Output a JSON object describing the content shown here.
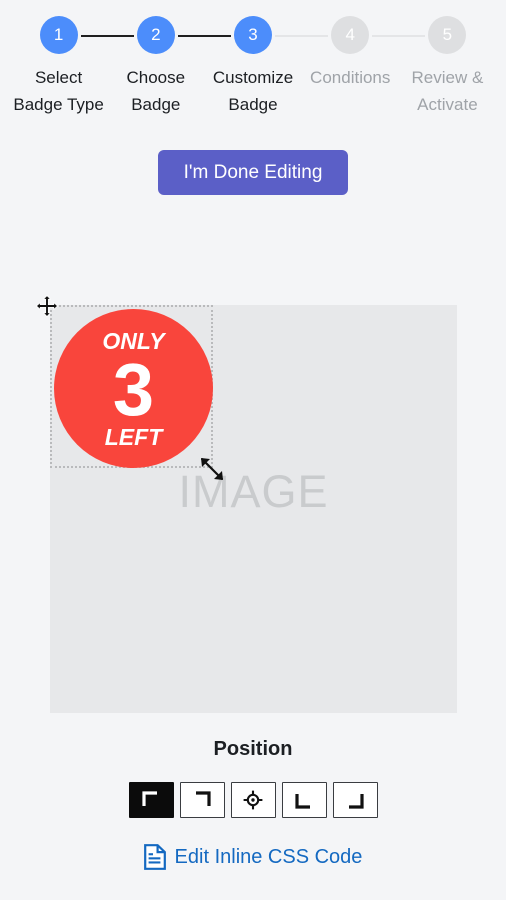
{
  "stepper": {
    "steps": [
      {
        "number": "1",
        "label": "Select Badge Type",
        "state": "done"
      },
      {
        "number": "2",
        "label": "Choose Badge",
        "state": "done"
      },
      {
        "number": "3",
        "label": "Customize Badge",
        "state": "done"
      },
      {
        "number": "4",
        "label": "Conditions",
        "state": "todo"
      },
      {
        "number": "5",
        "label": "Review & Activate",
        "state": "todo"
      }
    ],
    "active_color": "#4c8dfb",
    "inactive_color": "#dedfe1"
  },
  "toolbar": {
    "done_label": "I'm Done Editing",
    "done_color": "#5b5fc7"
  },
  "canvas": {
    "image_placeholder": "IMAGE",
    "badge": {
      "top_text": "ONLY",
      "number": "3",
      "bottom_text": "LEFT",
      "color": "#f9453c",
      "text_color": "#ffffff",
      "shape": "circle"
    },
    "move_handle": "move-arrows-icon",
    "resize_handle": "resize-diagonal-icon"
  },
  "position": {
    "title": "Position",
    "selected": "top-left",
    "options": [
      {
        "value": "top-left",
        "icon": "corner-top-left-icon",
        "selected": true
      },
      {
        "value": "top-right",
        "icon": "corner-top-right-icon",
        "selected": false
      },
      {
        "value": "center",
        "icon": "crosshair-icon",
        "selected": false
      },
      {
        "value": "bottom-left",
        "icon": "corner-bottom-left-icon",
        "selected": false
      },
      {
        "value": "bottom-right",
        "icon": "corner-bottom-right-icon",
        "selected": false
      }
    ]
  },
  "css_link": {
    "label": "Edit Inline CSS Code",
    "icon": "document-text-icon",
    "color": "#1469c1"
  }
}
